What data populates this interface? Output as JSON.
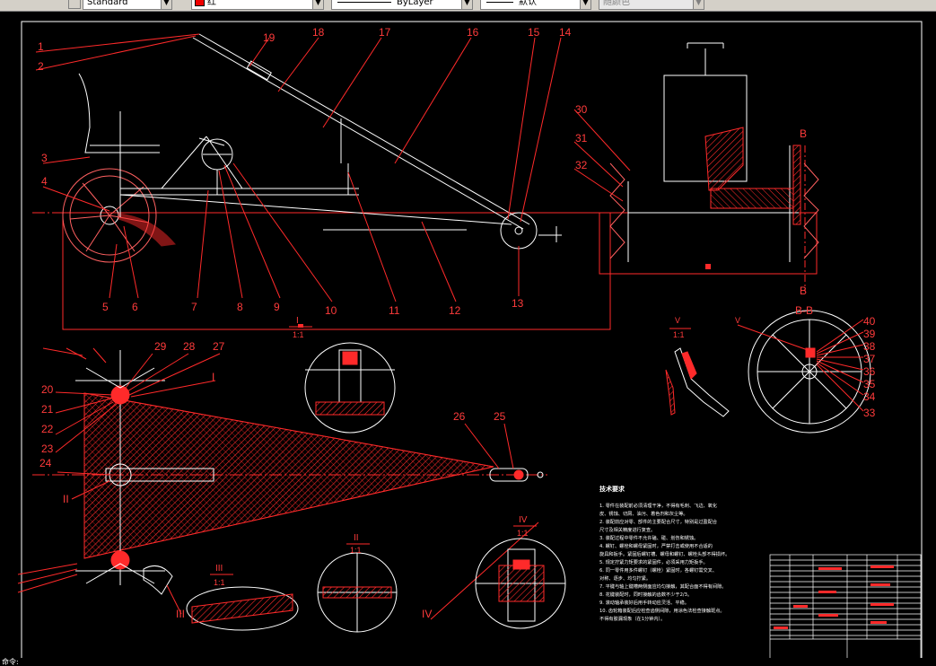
{
  "toolbar": {
    "textstyle": "Standard",
    "color": "红",
    "linetype": "ByLayer",
    "lineweight": "默认",
    "plotstyle": "随颜色",
    "swatch_color": "#e00000"
  },
  "command_line": "命令:",
  "drawing": {
    "balloons_top": [
      "1",
      "2",
      "3",
      "4",
      "5",
      "6",
      "7",
      "8",
      "9",
      "10",
      "11",
      "12",
      "13",
      "14",
      "15",
      "16",
      "17",
      "18",
      "19"
    ],
    "balloons_right": [
      "30",
      "31",
      "32"
    ],
    "balloons_plan": [
      "20",
      "21",
      "22",
      "23",
      "24",
      "25",
      "26",
      "27",
      "28",
      "29",
      "I",
      "II",
      "III",
      "IV"
    ],
    "balloons_wheel": [
      "33",
      "34",
      "35",
      "36",
      "37",
      "38",
      "39",
      "40"
    ],
    "section_label": "B",
    "section_title": "B-B",
    "detail_v": "V",
    "detail_v_scale": "1:1",
    "detail_i": "I",
    "detail_i_scale": "1:1",
    "detail_ii": "II",
    "detail_ii_scale": "1:1",
    "detail_iii": "III",
    "detail_iii_scale": "1:1",
    "detail_iv": "IV",
    "detail_iv_scale": "1:1",
    "requirements_title": "技术要求",
    "requirements": [
      "1. 零件在装配前必须清理干净，不得有毛刺、飞边、氧化",
      "皮、锈蚀、切屑、油污、着色剂和灰尘等。",
      "2. 装配前应对零、部件的主要配合尺寸，特别是过盈配合",
      "尺寸及相关精度进行复查。",
      "3. 装配过程中零件不允许磕、碰、划伤和锈蚀。",
      "4. 螺钉、螺栓和螺母紧固时，严禁打击或使用不合适的",
      "旋具和扳手。紧固后螺钉槽、螺母和螺钉、螺栓头部不得损坏。",
      "5. 规定拧紧力矩要求的紧固件，必须采用力矩扳手。",
      "6. 同一零件用多件螺钉（螺栓）紧固时，各螺钉需交叉、",
      "对称、逐步、均匀拧紧。",
      "7. 平键与轴上键槽两侧面应均匀接触，其配合面不得有间隙。",
      "8. 花键装配时，同时接触的齿数不少于2/3。",
      "9. 滚动轴承装好后用手转动应灵活、平稳。",
      "10. 齿轮箱装配后应检查齿侧间隙，用涂色法检查接触斑点。",
      "不得有胶漏现象（在1分钟内）。"
    ]
  },
  "colors": {
    "drawing": "#ff2a2a",
    "background": "#000000",
    "text": "#ffffff",
    "frame": "#ffffff"
  }
}
